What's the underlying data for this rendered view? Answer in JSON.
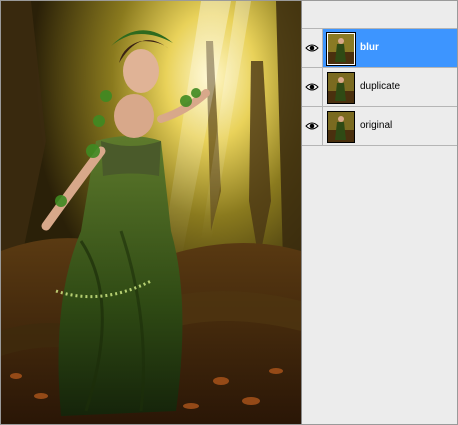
{
  "layers_panel": {
    "layers": [
      {
        "name": "blur",
        "selected": true,
        "visible": true,
        "visibility_icon": "eye-icon"
      },
      {
        "name": "duplicate",
        "selected": false,
        "visible": true,
        "visibility_icon": "eye-icon"
      },
      {
        "name": "original",
        "selected": false,
        "visible": true,
        "visibility_icon": "eye-icon"
      }
    ],
    "selection_color": "#3d95ff"
  },
  "canvas": {
    "subject": "fantasy forest woman in green dress"
  }
}
